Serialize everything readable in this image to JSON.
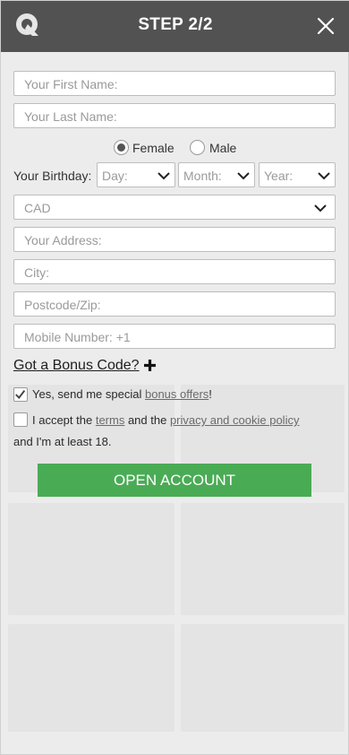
{
  "header": {
    "title": "STEP 2/2"
  },
  "form": {
    "first_name": {
      "placeholder": "Your First Name:"
    },
    "last_name": {
      "placeholder": "Your Last Name:"
    },
    "gender": {
      "female": "Female",
      "male": "Male",
      "selected": "Female"
    },
    "birthday": {
      "label": "Your Birthday:",
      "day": "Day:",
      "month": "Month:",
      "year": "Year:"
    },
    "currency": {
      "value": "CAD"
    },
    "address": {
      "placeholder": "Your Address:"
    },
    "city": {
      "placeholder": "City:"
    },
    "postcode": {
      "placeholder": "Postcode/Zip:"
    },
    "mobile": {
      "placeholder": "Mobile Number: +1"
    },
    "bonus_code": "Got a Bonus Code?",
    "offers": {
      "prefix": "Yes, send me special ",
      "link": "bonus offers",
      "suffix": "!",
      "checked": true
    },
    "terms": {
      "prefix": "I accept the ",
      "terms_link": "terms",
      "middle": " and the ",
      "privacy_link": "privacy and cookie policy",
      "line2": "and I'm at least 18.",
      "checked": false
    },
    "submit": "OPEN ACCOUNT"
  },
  "colors": {
    "header": "#525252",
    "button": "#4aab55",
    "background": "#ececec"
  },
  "icons": {
    "logo": "brand-logo-icon",
    "close": "close-icon",
    "plus": "plus-icon",
    "chevron": "chevron-down-icon"
  }
}
